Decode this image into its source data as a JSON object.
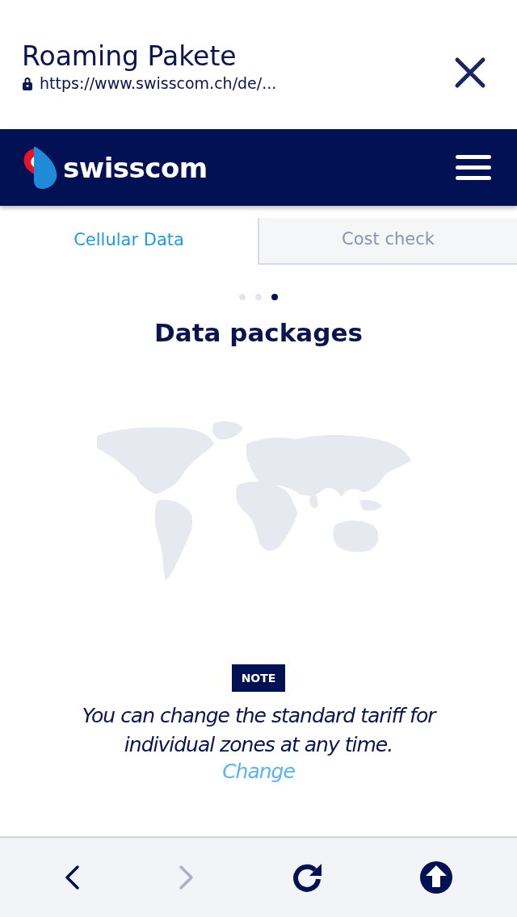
{
  "browser_header": {
    "title": "Roaming Pakete",
    "url": "https://www.swisscom.ch/de/..."
  },
  "navbar": {
    "logo_text": "swisscom"
  },
  "tabs": [
    {
      "label": "Cellular Data",
      "selected": true
    },
    {
      "label": "Cost check",
      "selected": false
    }
  ],
  "pager": [
    {
      "selected": false
    },
    {
      "selected": false
    },
    {
      "selected": true
    }
  ],
  "heading": "Data packages",
  "note": {
    "badge": "NOTE",
    "text": "You can change the standard tariff for individual zones at any time.",
    "link": "Change"
  },
  "toolbar": [
    {
      "kind": "back",
      "disabled": false
    },
    {
      "kind": "forward",
      "disabled": true
    },
    {
      "kind": "reload",
      "disabled": false
    },
    {
      "kind": "share",
      "disabled": false
    }
  ]
}
